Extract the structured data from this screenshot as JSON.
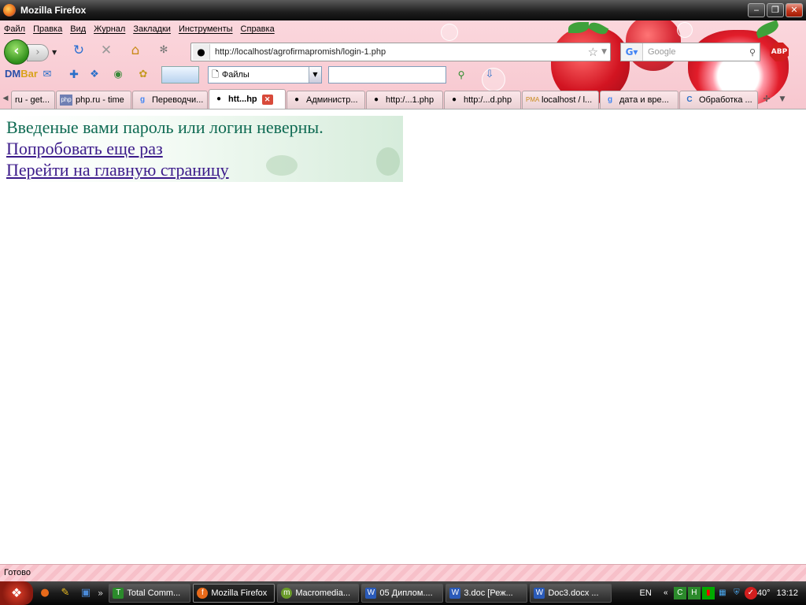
{
  "window": {
    "title": "Mozilla Firefox",
    "minimize": "‒",
    "restore": "❐",
    "close": "✕"
  },
  "menu": [
    "Файл",
    "Правка",
    "Вид",
    "Журнал",
    "Закладки",
    "Инструменты",
    "Справка"
  ],
  "navbar": {
    "url": "http://localhost/agrofirmapromish/login-1.php",
    "search_placeholder": "Google",
    "search_engine_icon": "google-icon",
    "adblock_label": "ABP"
  },
  "toolbar2": {
    "dmbar_label_a": "DM",
    "dmbar_label_b": "Bar",
    "select_value": "Файлы",
    "text_value": ""
  },
  "tabs": [
    {
      "label": "ru - get...",
      "icon": "",
      "active": false
    },
    {
      "label": "php.ru - time",
      "icon": "php",
      "active": false
    },
    {
      "label": "Переводчи...",
      "icon": "g",
      "active": false
    },
    {
      "label": "htt...hp",
      "icon": "spy",
      "active": true
    },
    {
      "label": "Администр...",
      "icon": "spy",
      "active": false
    },
    {
      "label": "http:/...1.php",
      "icon": "spy",
      "active": false
    },
    {
      "label": "http:/...d.php",
      "icon": "spy",
      "active": false
    },
    {
      "label": "localhost / l...",
      "icon": "pma",
      "active": false
    },
    {
      "label": "дата и вре...",
      "icon": "g",
      "active": false
    },
    {
      "label": "Обработка ...",
      "icon": "c",
      "active": false
    }
  ],
  "page": {
    "message": "Введеные вами пароль или логин неверны.",
    "retry_link": "Попробовать еще раз",
    "home_link": "Перейти на главную страницу"
  },
  "status": "Готово",
  "taskbar": {
    "tasks": [
      {
        "label": "Total Comm...",
        "active": false
      },
      {
        "label": "Mozilla Firefox",
        "active": true
      },
      {
        "label": "Macromedia...",
        "active": false
      },
      {
        "label": "05 Диплом....",
        "active": false
      },
      {
        "label": "3.doc [Реж...",
        "active": false
      },
      {
        "label": "Doc3.docx ...",
        "active": false
      }
    ],
    "lang": "EN",
    "temp": "40°",
    "clock": "13:12"
  },
  "colors": {
    "message": "#0e6a52",
    "link": "#3b1a8a",
    "theme_pink": "#f7c7cf"
  }
}
